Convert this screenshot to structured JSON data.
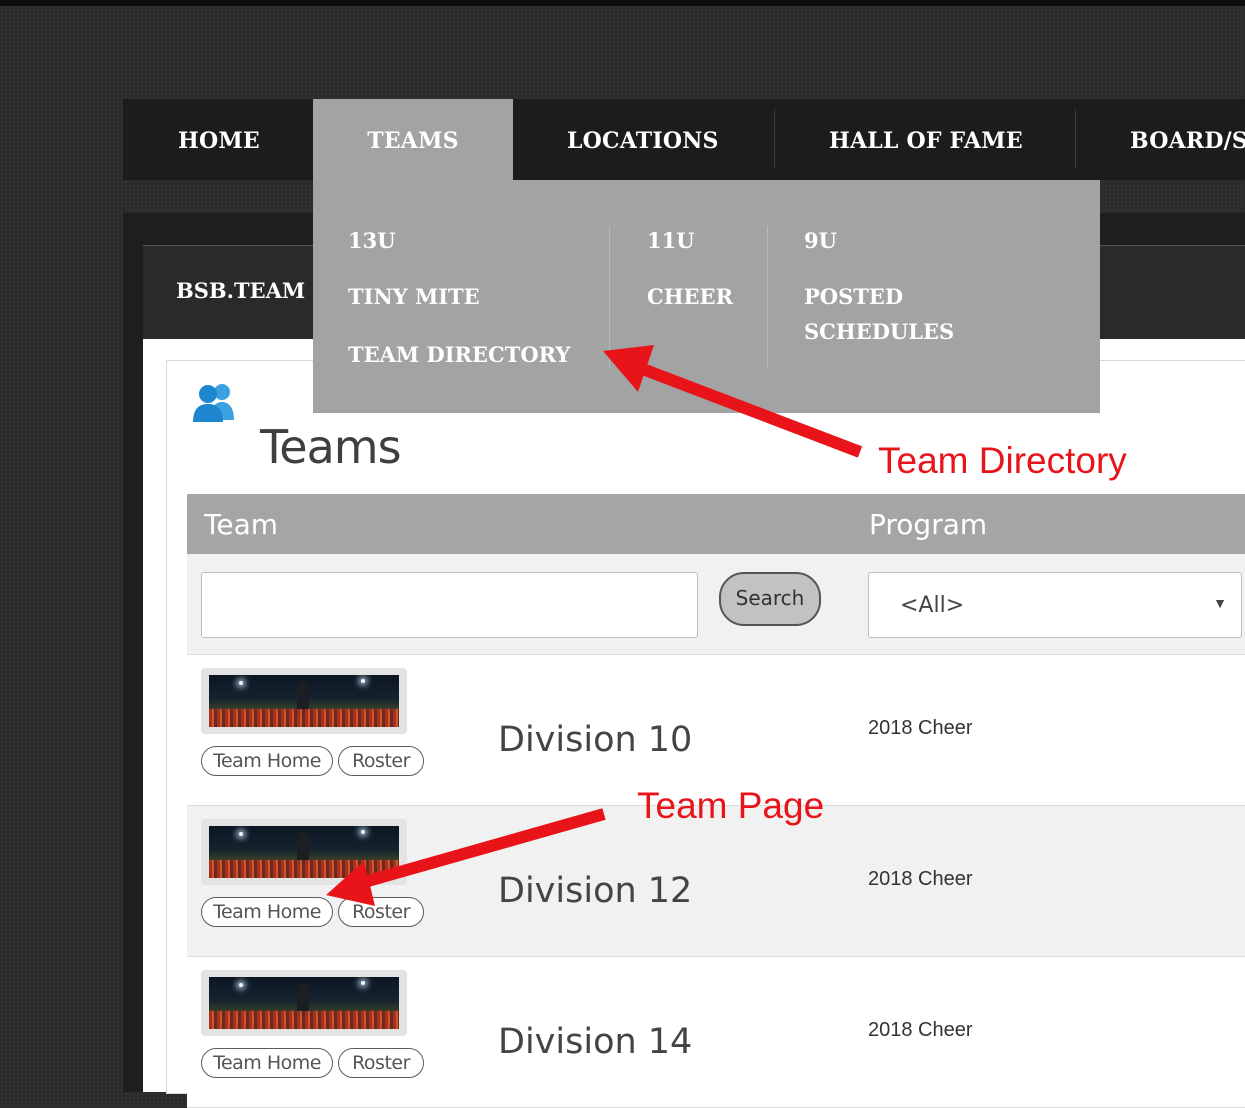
{
  "nav": {
    "items": [
      {
        "label": "HOME"
      },
      {
        "label": "TEAMS"
      },
      {
        "label": "LOCATIONS"
      },
      {
        "label": "HALL OF FAME"
      },
      {
        "label": "BOARD/S"
      }
    ]
  },
  "dropdown": {
    "col1": [
      "13U",
      "TINY MITE",
      "TEAM DIRECTORY"
    ],
    "col2": [
      "11U",
      "CHEER"
    ],
    "col3": [
      "9U",
      "POSTED",
      "SCHEDULES"
    ]
  },
  "subbar": {
    "title": "BSB.TEAM"
  },
  "page": {
    "title": "Teams"
  },
  "table": {
    "headers": {
      "team": "Team",
      "program": "Program"
    },
    "search_button": "Search",
    "program_filter": "<All>",
    "rows": [
      {
        "name": "Division 10",
        "program": "2018 Cheer",
        "team_home": "Team Home",
        "roster": "Roster"
      },
      {
        "name": "Division 12",
        "program": "2018 Cheer",
        "team_home": "Team Home",
        "roster": "Roster"
      },
      {
        "name": "Division 14",
        "program": "2018 Cheer",
        "team_home": "Team Home",
        "roster": "Roster"
      }
    ]
  },
  "annotations": {
    "team_directory": "Team Directory",
    "team_page": "Team Page"
  },
  "colors": {
    "annotation": "#e8141a",
    "nav_bg": "#1c1c1c",
    "dropdown_bg": "#a3a3a3",
    "header_bg": "#a5a5a5"
  },
  "icons": {
    "teams": "users-icon",
    "select": "triangle-down-icon"
  }
}
